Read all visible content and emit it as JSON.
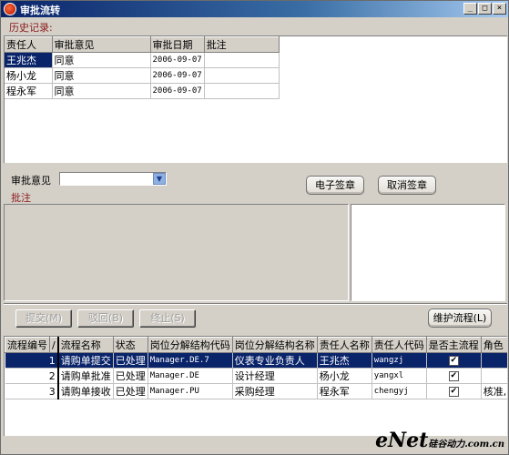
{
  "window": {
    "title": "审批流转",
    "minimize": "_",
    "restore": "□",
    "close": "×"
  },
  "history": {
    "label": "历史记录:",
    "columns": [
      "责任人",
      "审批意见",
      "审批日期",
      "批注"
    ],
    "rows": [
      {
        "person": "王兆杰",
        "opinion": "同意",
        "date": "2006-09-07",
        "note": ""
      },
      {
        "person": "杨小龙",
        "opinion": "同意",
        "date": "2006-09-07",
        "note": ""
      },
      {
        "person": "程永军",
        "opinion": "同意",
        "date": "2006-09-07",
        "note": ""
      }
    ]
  },
  "approval": {
    "opinion_label": "审批意见",
    "opinion_value": "",
    "note_label": "批注",
    "sign_button": "电子签章",
    "cancel_sign_button": "取消签章"
  },
  "actions": {
    "submit": "提交(M)",
    "reject": "驳回(B)",
    "stop": "终止(S)",
    "maintain": "维护流程(L)"
  },
  "flow": {
    "columns": [
      "流程编号",
      "/",
      "流程名称",
      "状态",
      "岗位分解结构代码",
      "岗位分解结构名称",
      "责任人名称",
      "责任人代码",
      "是否主流程",
      "角色"
    ],
    "rows": [
      {
        "no": "1",
        "name": "请购单提交",
        "status": "已处理",
        "code": "Manager.DE.7",
        "post": "仪表专业负责人",
        "person": "王兆杰",
        "pcode": "wangzj",
        "main": "✔",
        "role": ""
      },
      {
        "no": "2",
        "name": "请购单批准",
        "status": "已处理",
        "code": "Manager.DE",
        "post": "设计经理",
        "person": "杨小龙",
        "pcode": "yangxl",
        "main": "✔",
        "role": ""
      },
      {
        "no": "3",
        "name": "请购单接收",
        "status": "已处理",
        "code": "Manager.PU",
        "post": "采购经理",
        "person": "程永军",
        "pcode": "chengyj",
        "main": "✔",
        "role": "核准,"
      }
    ]
  },
  "watermark": {
    "brand": "eNet",
    "suffix": "硅谷动力",
    "domain": ".com.cn"
  }
}
